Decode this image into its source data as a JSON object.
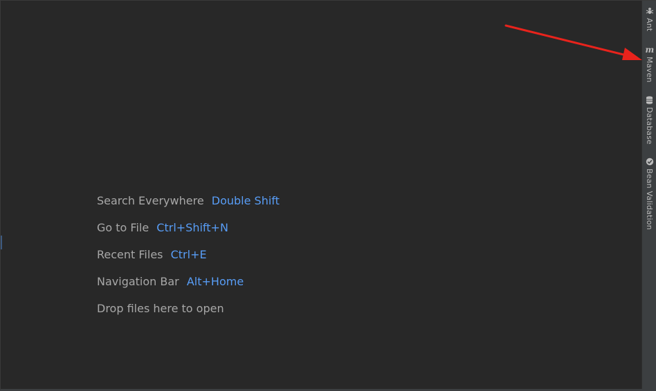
{
  "editor": {
    "hints": [
      {
        "label": "Search Everywhere",
        "shortcut": "Double Shift"
      },
      {
        "label": "Go to File",
        "shortcut": "Ctrl+Shift+N"
      },
      {
        "label": "Recent Files",
        "shortcut": "Ctrl+E"
      },
      {
        "label": "Navigation Bar",
        "shortcut": "Alt+Home"
      }
    ],
    "drop_hint": "Drop files here to open"
  },
  "right_toolbar": {
    "items": [
      {
        "label": "Ant",
        "icon": "ant-icon"
      },
      {
        "label": "Maven",
        "icon": "maven-icon"
      },
      {
        "label": "Database",
        "icon": "database-icon"
      },
      {
        "label": "Bean Validation",
        "icon": "bean-validation-icon"
      }
    ]
  },
  "colors": {
    "background": "#282828",
    "hint_text": "#a8a8a8",
    "shortcut_text": "#589df6",
    "stripe_background": "#3c3f41",
    "annotation_arrow": "#e8231c"
  }
}
